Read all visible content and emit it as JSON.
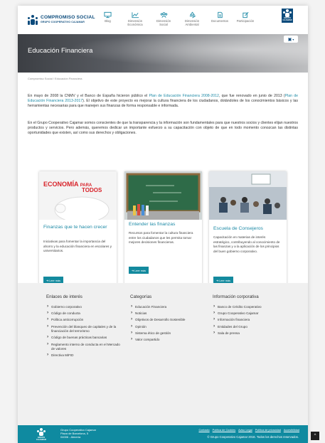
{
  "header": {
    "logo_title": "COMPROMISO SOCIAL",
    "logo_subtitle": "GRUPO COOPERATIVO CAJAMAR",
    "nav": [
      {
        "label": "Blog",
        "icon": "monitor-icon"
      },
      {
        "label": "Dimensión Económica",
        "icon": "chart-icon"
      },
      {
        "label": "Dimensión Social",
        "icon": "people-icon"
      },
      {
        "label": "Dimensión Ambiental",
        "icon": "recycle-icon"
      },
      {
        "label": "Documentos",
        "icon": "document-icon"
      },
      {
        "label": "Participación",
        "icon": "pencil-icon"
      }
    ],
    "grupo_badge": "GRUPO CAJAMAR"
  },
  "hero": {
    "title": "Educación Financiera",
    "lang_caret": "▾"
  },
  "breadcrumb": "Compromiso Social / Educación Financiera",
  "intro": {
    "p1_a": "En mayo de 2008 la CNMV y el Banco de España hicieron público el ",
    "p1_link1": "Plan de Educación Financiera 2008-2012",
    "p1_b": ", que fue renovado en junio de 2013 (",
    "p1_link2": "Plan de Educación Financiera 2013-2017",
    "p1_c": "). El objetivo de este proyecto es mejorar la cultura financiera de los ciudadanos, dotándoles de los conocimientos básicos y las herramientas necesarias para que manejen sus finanzas de forma responsable e informada.",
    "p2": "En el Grupo Cooperativo Cajamar somos conscientes de que la transparencia y la información son fundamentales para que nuestros socios y clientes elijan nuestros productos y servicios. Pero además, queremos dedicar un importante esfuerzo a su capacitación con objeto de que en todo momento conozcan las distintas oportunidades que existen, así como sus derechos y obligaciones."
  },
  "cards": [
    {
      "image_title_a": "ECONOMÍA",
      "image_title_b": "PARA",
      "image_title_c": "TODOS",
      "title": "Finanzas que te hacen crecer",
      "text": "Iniciativas para fomentar la importancia del ahorro y la educación financiera en escolares y universitarios.",
      "button": "➔ Leer más"
    },
    {
      "title": "Entender las finanzas",
      "text": "Recursos para fomentar la cultura financiera entre los ciudadanos que les permita tomar mejores decisiones financieras.",
      "button": "➔ Leer más"
    },
    {
      "title": "Escuela de Consejeros",
      "text": "Capacitación en materias de interés estratégico, contribuyendo al conocimiento de las finanzas y a la aplicación de los principios del buen gobierno corporativo.",
      "button": "➔ Leer más"
    }
  ],
  "footer": {
    "col1": {
      "title": "Enlaces de interés",
      "items": [
        "Gobierno corporativo",
        "Código de conducta",
        "Política anticorrupción",
        "Prevención del blanqueo de capitales y de la financiación del terrorismo",
        "Código de buenas prácticas bancarias",
        "Reglamento interno de conducta en el Mercado de valores",
        "Directiva MiFID"
      ]
    },
    "col2": {
      "title": "Categorías",
      "items": [
        "Educación Financiera",
        "Noticias",
        "Objetivos de Desarrollo Sostenible",
        "Opinión",
        "Sistema ético de gestión",
        "Valor compartido"
      ]
    },
    "col3": {
      "title": "Información corporativa",
      "items": [
        "Banco de Crédito Cooperativo",
        "Grupo Cooperativo Cajamar",
        "Información financiera",
        "Entidades del Grupo",
        "Sala de prensa"
      ]
    },
    "address": [
      "Grupo Cooperativo Cajamar",
      "Plaza de Barcelona, 5",
      "04006 - Almería"
    ],
    "logo_label": "GRUPO CAJAMAR",
    "links": [
      "Contacto",
      "Política de Cookies",
      "Aviso Legal",
      "Política de privacidad",
      "Accesibilidad"
    ],
    "copyright": "© Grupo Cooperativo Cajamar 2016. Todos los derechos reservados.",
    "scroll_top": "^"
  },
  "colors": {
    "brand": "#0b4b7c",
    "accent": "#1d8aa6",
    "footer": "#0f8aa0",
    "button": "#138a9e"
  }
}
